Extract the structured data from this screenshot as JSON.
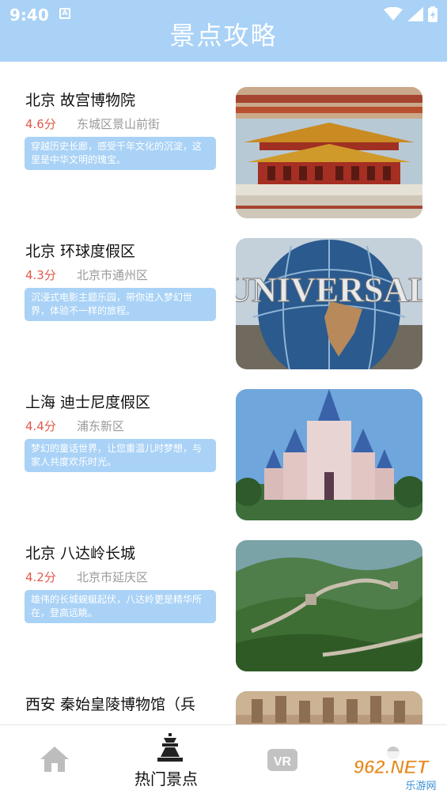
{
  "status": {
    "time": "9:40",
    "notif_letter": "A"
  },
  "header": {
    "title": "景点攻略"
  },
  "attractions": [
    {
      "name": "北京 故宫博物院",
      "score": "4.6分",
      "address": "东城区景山前街",
      "desc": "穿越历史长廊，感受千年文化的沉淀，这里是中华文明的瑰宝。",
      "image": "forbidden-city-photo"
    },
    {
      "name": "北京 环球度假区",
      "score": "4.3分",
      "address": "北京市通州区",
      "desc": "沉浸式电影主题乐园，带你进入梦幻世界，体验不一样的旅程。",
      "image": "universal-globe-photo",
      "image_text": "UNIVERSAL"
    },
    {
      "name": "上海 迪士尼度假区",
      "score": "4.4分",
      "address": "浦东新区",
      "desc": "梦幻的童话世界，让您重温儿时梦想，与家人共度欢乐时光。",
      "image": "disney-castle-photo"
    },
    {
      "name": "北京 八达岭长城",
      "score": "4.2分",
      "address": "北京市延庆区",
      "desc": "雄伟的长城蜿蜒起伏，八达岭更是精华所在，登高远眺。",
      "image": "great-wall-photo"
    },
    {
      "name": "西安 秦始皇陵博物馆（兵",
      "score": "",
      "address": "",
      "desc": "",
      "image": "terracotta-photo"
    }
  ],
  "bottom_nav": {
    "items": [
      {
        "label": "",
        "icon": "home-icon"
      },
      {
        "label": "热门景点",
        "icon": "tower-icon"
      },
      {
        "label": "",
        "icon": "vr-icon"
      }
    ]
  },
  "watermark": {
    "text": "962.NET",
    "sub": "乐游网"
  },
  "colors": {
    "header": "#a9d2f6",
    "score": "#e05a4c",
    "address": "#999999"
  }
}
